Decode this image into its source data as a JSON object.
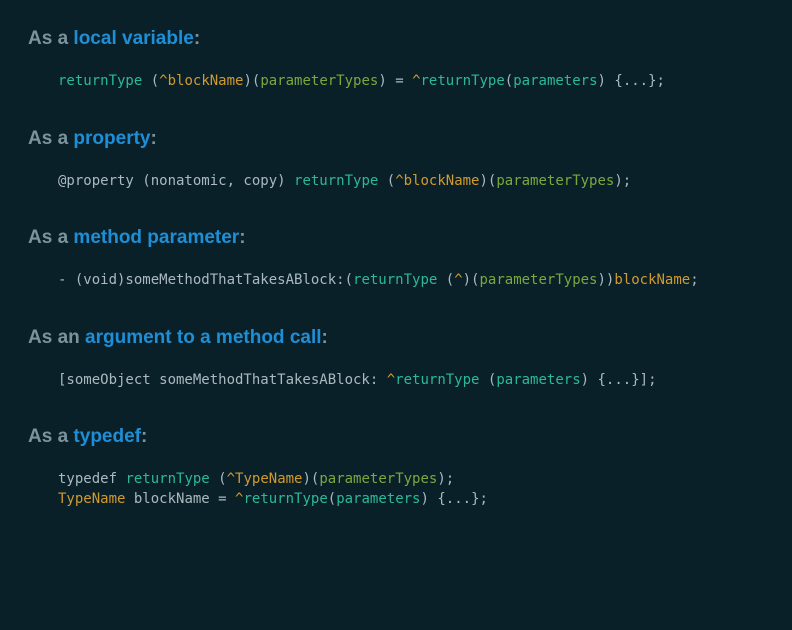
{
  "sections": [
    {
      "h_pre": "As a ",
      "h_emph": "local variable",
      "h_post": ":",
      "code_html": "<span class='rt'>returnType</span> <span class='punc'>(</span><span class='caret'>^</span><span class='bn'>blockName</span><span class='punc'>)(</span><span class='pt'>parameterTypes</span><span class='punc'>) = </span><span class='caret'>^</span><span class='rt'>returnType</span><span class='punc'>(</span><span class='rt'>parameters</span><span class='punc'>) {...};</span>"
    },
    {
      "h_pre": "As a ",
      "h_emph": "property",
      "h_post": ":",
      "code_html": "<span class='punc'>@property (nonatomic, copy) </span><span class='rt'>returnType</span> <span class='punc'>(</span><span class='caret'>^</span><span class='bn'>blockName</span><span class='punc'>)(</span><span class='pt'>parameterTypes</span><span class='punc'>);</span>"
    },
    {
      "h_pre": "As a ",
      "h_emph": "method parameter",
      "h_post": ":",
      "code_html": "<span class='punc'>- (void)someMethodThatTakesABlock:(</span><span class='rt'>returnType</span> <span class='punc'>(</span><span class='caret'>^</span><span class='punc'>)(</span><span class='pt'>parameterTypes</span><span class='punc'>))</span><span class='bn'>blockName</span><span class='punc'>;</span>"
    },
    {
      "h_pre": "As an ",
      "h_emph": "argument to a method call",
      "h_post": ":",
      "code_html": "<span class='punc'>[someObject someMethodThatTakesABlock: </span><span class='caret'>^</span><span class='rt'>returnType</span> <span class='punc'>(</span><span class='rt'>parameters</span><span class='punc'>) {...}];</span>"
    },
    {
      "h_pre": "As a ",
      "h_emph": "typedef",
      "h_post": ":",
      "code_html": "<span class='punc'>typedef </span><span class='rt'>returnType</span> <span class='punc'>(</span><span class='caret'>^</span><span class='bn'>TypeName</span><span class='punc'>)(</span><span class='pt'>parameterTypes</span><span class='punc'>);</span>\n<span class='bn'>TypeName</span> <span class='punc'>blockName = </span><span class='caret'>^</span><span class='rt'>returnType</span><span class='punc'>(</span><span class='rt'>parameters</span><span class='punc'>) {...};</span>"
    }
  ]
}
